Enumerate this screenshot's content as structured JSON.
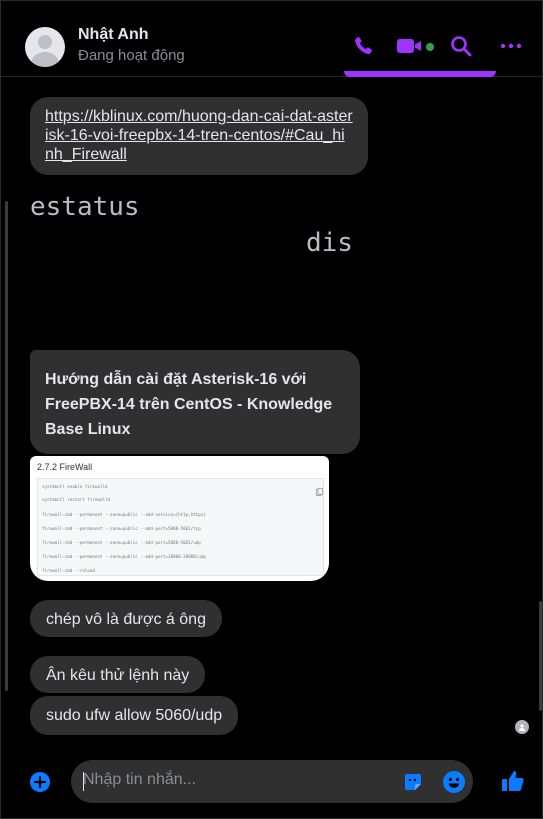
{
  "header": {
    "name": "Nhật Anh",
    "status": "Đang hoạt động"
  },
  "messages": {
    "link": "https://kblinux.com/huong-dan-cai-dat-asterisk-16-voi-freepbx-14-tren-centos/#Cau_hinh_Firewall",
    "terminal_line1": "estatus",
    "terminal_line2": "dis",
    "card_title": "Hướng dẫn cài đặt Asterisk-16 với FreePBX-14 trên CentOS - Knowledge Base Linux",
    "preview_heading": "2.7.2 FireWall",
    "preview_lines": [
      "systemctl enable firewalld",
      "systemctl restart firewalld",
      "firewall-cmd --permanent --zone=public --add-service={http,https}",
      "firewall-cmd --permanent --zone=public --add-port=5060-5061/tcp",
      "firewall-cmd --permanent --zone=public --add-port=5060-5061/udp",
      "firewall-cmd --permanent --zone=public --add-port=10000-20000/udp",
      "firewall-cmd --reload"
    ],
    "msg1": "chép vô là được á ông",
    "msg2": "Ân kêu thử lệnh này",
    "msg3": "sudo ufw allow 5060/udp"
  },
  "composer": {
    "placeholder": "Nhập tin nhắn..."
  },
  "colors": {
    "accent": "#a033ff",
    "blue_accent": "#0a7cff",
    "online": "#31a24c",
    "bubble": "#303030",
    "background": "#000000"
  },
  "icons": [
    "phone-icon",
    "video-icon",
    "search-icon",
    "more-icon",
    "plus-icon",
    "sticker-icon",
    "emoji-icon",
    "like-icon",
    "copy-icon"
  ]
}
